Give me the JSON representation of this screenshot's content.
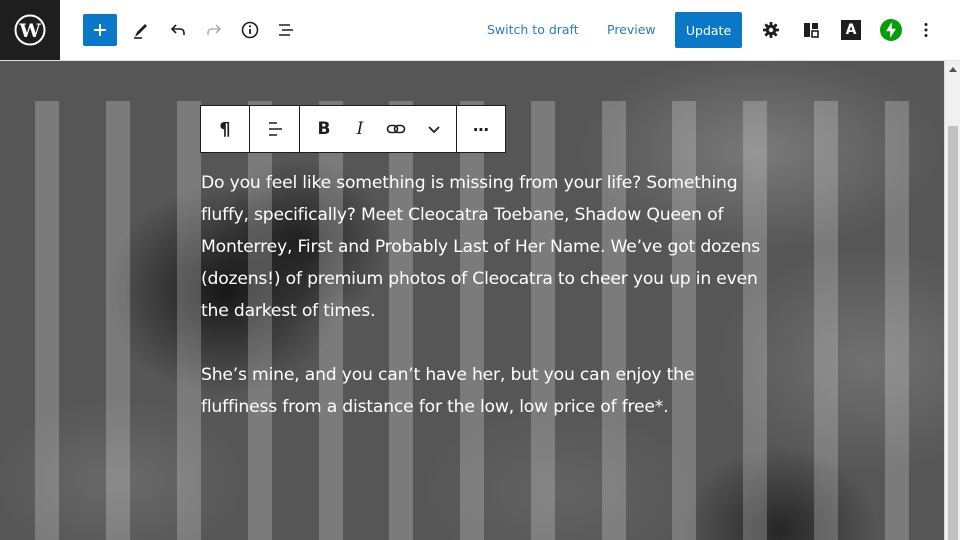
{
  "topbar": {
    "logo_icon": "wordpress-logo-icon",
    "add_block_icon": "plus-icon",
    "tools_icon": "pencil-icon",
    "undo_icon": "undo-icon",
    "redo_icon": "redo-icon",
    "details_icon": "info-icon",
    "list_view_icon": "list-view-icon",
    "switch_to_draft_label": "Switch to draft",
    "preview_label": "Preview",
    "update_label": "Update",
    "settings_icon": "gear-icon",
    "block_layout_icon": "layout-icon",
    "a_plugin_icon": "letter-a-icon",
    "a_plugin_letter": "A",
    "jetpack_icon": "jetpack-bolt-icon",
    "options_icon": "more-vertical-icon",
    "accent_color": "#0a78c6",
    "jetpack_color": "#069e08"
  },
  "block_toolbar": {
    "paragraph_symbol": "¶",
    "align_icon": "align-left-icon",
    "bold_label": "B",
    "italic_label": "I",
    "link_icon": "link-icon",
    "more_formats_icon": "chevron-down-icon",
    "options_label": "⋯"
  },
  "content": {
    "paragraph_1": "Do you feel like something is missing from your life? Something fluffy, specifically? Meet Cleocatra Toebane, Shadow Queen of Monterrey, First and Probably Last of Her Name. We’ve got dozens (dozens!) of premium photos of Cleocatra to cheer you up in even the darkest of times.",
    "paragraph_2": "She’s mine, and you can’t have her, but you can enjoy the fluffiness from a distance for the low, low price of free*."
  }
}
